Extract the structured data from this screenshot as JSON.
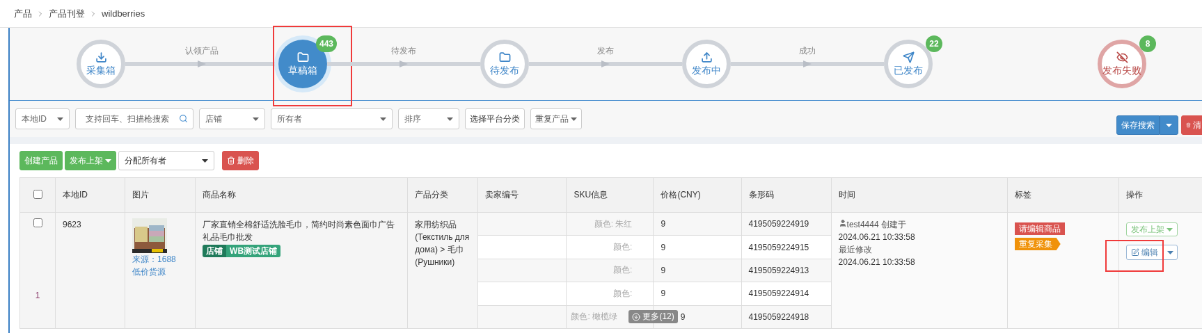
{
  "breadcrumb": [
    "产品",
    "产品刊登",
    "wildberries"
  ],
  "steps": [
    {
      "label": "采集箱",
      "selected": false,
      "failed": false
    },
    {
      "label": "草稿箱",
      "count": "443",
      "selected": true,
      "failed": false,
      "highlighted": true
    },
    {
      "label": "待发布",
      "selected": false,
      "failed": false
    },
    {
      "label": "发布中",
      "selected": false,
      "failed": false
    },
    {
      "label": "已发布",
      "count": "22",
      "selected": false,
      "failed": false
    },
    {
      "label": "发布失败",
      "count": "8",
      "selected": false,
      "failed": true
    }
  ],
  "connectors": [
    "认领产品",
    "待发布",
    "发布",
    "成功"
  ],
  "filters": [
    {
      "kind": "select",
      "value": "本地ID"
    },
    {
      "kind": "search",
      "placeholder": "支持回车、扫描枪搜索"
    },
    {
      "kind": "select",
      "value": "店铺"
    },
    {
      "kind": "wide-select",
      "value": "所有者"
    },
    {
      "kind": "select",
      "value": "排序"
    },
    {
      "kind": "button",
      "value": "选择平台分类"
    },
    {
      "kind": "dropdown",
      "value": "重复产品"
    }
  ],
  "save_search": "保存搜索",
  "clear": "清",
  "actions": {
    "create": "创建产品",
    "publish": "发布上架",
    "assign": "分配所有者",
    "delete": "删除"
  },
  "all_checked": false,
  "columns": [
    "本地ID",
    "图片",
    "商品名称",
    "产品分类",
    "卖家编号",
    "SKU信息",
    "价格(CNY)",
    "条形码",
    "时间",
    "标签",
    "操作"
  ],
  "rows": [
    {
      "number": "1",
      "checked": false,
      "id": "9623",
      "source": "来源：1688",
      "source_note": "低价货源",
      "name": "厂家直销全棉舒适洗脸毛巾，简约时尚素色面巾广告礼品毛巾批发",
      "shop_tags": [
        "店铺",
        "WB测试店铺"
      ],
      "category": "家用纺织品 (Текстиль для дома) > 毛巾 (Рушники)",
      "skus": [
        {
          "sku": "颜色: 朱红",
          "price": "9",
          "barcode": "4195059224919"
        },
        {
          "sku": "颜色:",
          "price": "9",
          "barcode": "4195059224915"
        },
        {
          "sku": "颜色:",
          "price": "9",
          "barcode": "4195059224913"
        },
        {
          "sku": "颜色:",
          "price": "9",
          "barcode": "4195059224914"
        },
        {
          "sku": "颜色: 橄榄绿",
          "price": "9",
          "barcode": "4195059224918"
        }
      ],
      "more": "更多(12)",
      "user": "test4444",
      "created_label": "创建于",
      "created": "2024.06.21 10:33:58",
      "modified_label": "最近修改",
      "modified": "2024.06.21 10:33:58",
      "labels": [
        {
          "text": "请编辑商品",
          "kind": "plain",
          "color": "#d9534f"
        },
        {
          "text": "重复采集",
          "kind": "flag",
          "color": "#f0920a"
        }
      ],
      "publish": "发布上架",
      "edit": "编辑",
      "edit_highlighted": true
    }
  ]
}
